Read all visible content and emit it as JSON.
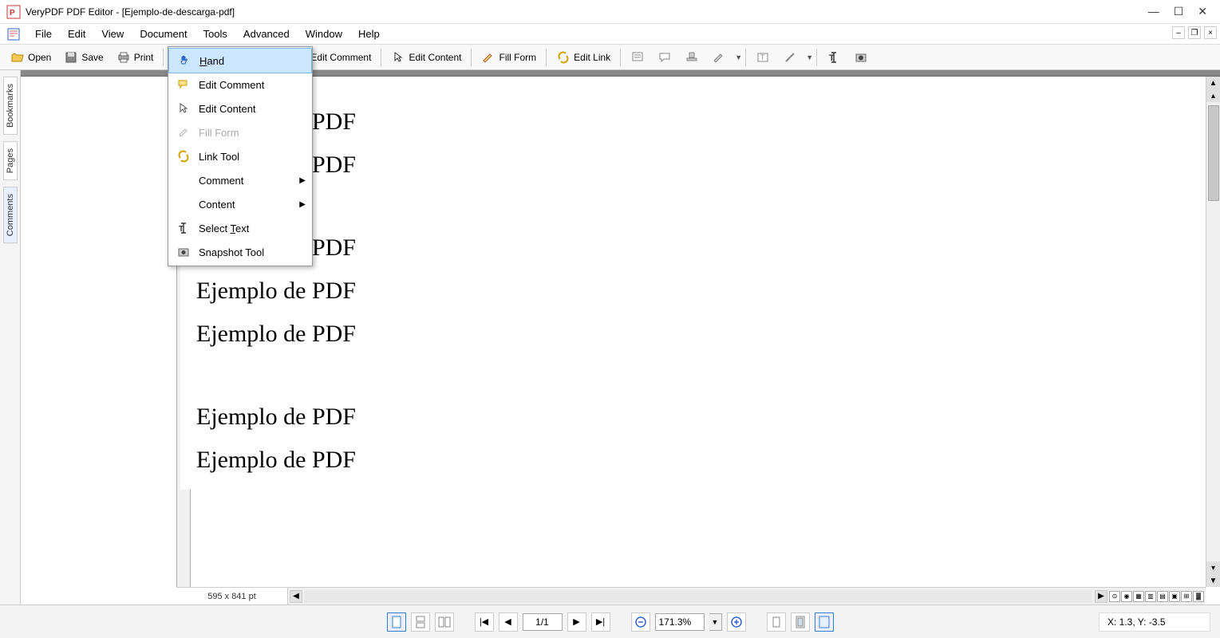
{
  "app": {
    "title": "VeryPDF PDF Editor - [Ejemplo-de-descarga-pdf]"
  },
  "menubar": {
    "items": [
      "File",
      "Edit",
      "View",
      "Document",
      "Tools",
      "Advanced",
      "Window",
      "Help"
    ]
  },
  "toolbar": {
    "open": "Open",
    "save": "Save",
    "print": "Print",
    "edit_comment": "Edit Comment",
    "edit_content": "Edit Content",
    "fill_form": "Fill Form",
    "edit_link": "Edit Link"
  },
  "dropdown": {
    "hand_pre": "H",
    "hand_post": "and",
    "edit_comment": "Edit Comment",
    "edit_content": "Edit Content",
    "fill_form": "Fill Form",
    "link_tool": "Link Tool",
    "comment": "Comment",
    "content": "Content",
    "select_text_pre": "Select ",
    "select_text_mid": "T",
    "select_text_post": "ext",
    "snapshot": "Snapshot Tool"
  },
  "side_tabs": {
    "bookmarks": "Bookmarks",
    "pages": "Pages",
    "comments": "Comments"
  },
  "document": {
    "lines": [
      "Ejemplo de PDF",
      "Ejemplo de PDF",
      "Ejemplo de PDF",
      "Ejemplo de PDF",
      "Ejemplo de PDF",
      "Ejemplo de PDF",
      "Ejemplo de PDF"
    ],
    "page_dimensions": "595 x 841 pt"
  },
  "statusbar": {
    "page_indicator": "1/1",
    "zoom": "171.3%",
    "coords": "X: 1.3, Y: -3.5"
  }
}
